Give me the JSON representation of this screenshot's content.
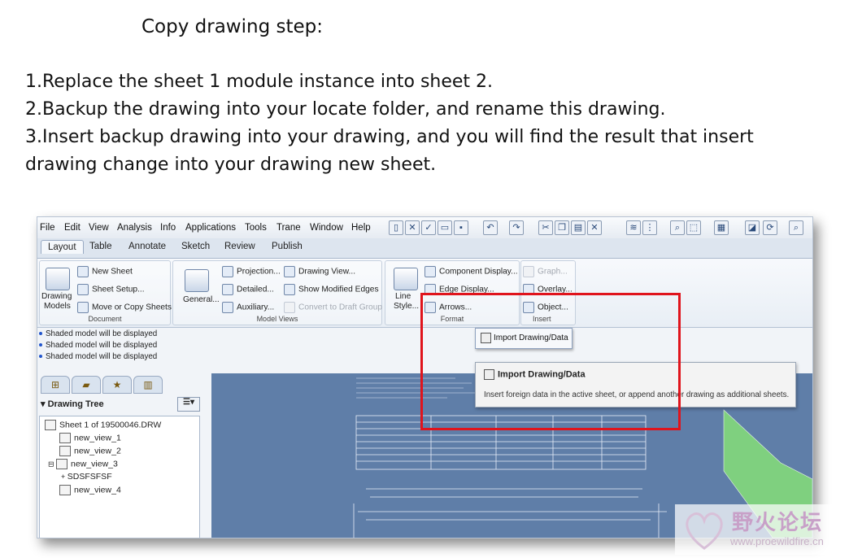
{
  "slide": {
    "title": "Copy drawing step:",
    "steps": [
      "1.Replace the sheet 1 module instance into sheet 2.",
      "2.Backup the drawing into your locate folder, and rename this drawing.",
      "3.Insert backup drawing into your drawing, and you will find the result that insert drawing change into your drawing new sheet."
    ]
  },
  "app": {
    "menu": [
      "File",
      "Edit",
      "View",
      "Analysis",
      "Info",
      "Applications",
      "Tools",
      "Trane",
      "Window",
      "Help"
    ],
    "tabs": [
      "Layout",
      "Table",
      "Annotate",
      "Sketch",
      "Review",
      "Publish"
    ],
    "active_tab": "Layout",
    "ribbon": {
      "document": {
        "label": "Document",
        "drawing_models": [
          "Drawing",
          "Models"
        ],
        "new_sheet": "New Sheet",
        "sheet_setup": "Sheet Setup...",
        "move_copy": "Move or Copy Sheets"
      },
      "model_views": {
        "label": "Model Views",
        "general": "General...",
        "projection": "Projection...",
        "detailed": "Detailed...",
        "auxiliary": "Auxiliary...",
        "drawing_view": "Drawing View...",
        "show_modified_edges": "Show Modified Edges",
        "convert_draft": "Convert to Draft Group"
      },
      "format": {
        "label": "Format",
        "line_style": [
          "Line",
          "Style..."
        ],
        "component_display": "Component Display...",
        "edge_display": "Edge Display...",
        "arrows": "Arrows..."
      },
      "insert": {
        "label": "Insert",
        "graph": "Graph...",
        "overlay": "Overlay...",
        "object": "Object..."
      }
    },
    "messages": [
      "Shaded model will be displayed",
      "Shaded model will be displayed",
      "Shaded model will be displayed"
    ],
    "tree": {
      "header": "Drawing Tree",
      "items": [
        "Sheet 1 of 19500046.DRW",
        "new_view_1",
        "new_view_2",
        "new_view_3",
        "SDSFSFSF",
        "new_view_4"
      ]
    },
    "dropdown_item": "Import Drawing/Data",
    "tooltip": {
      "title": "Import Drawing/Data",
      "description": "Insert foreign data in the active sheet, or append another drawing as additional sheets."
    }
  },
  "watermark": {
    "name": "野火论坛",
    "url": "www.proewildfire.cn"
  },
  "colors": {
    "highlight": "#e0141c",
    "canvas": "#5f7ea8"
  }
}
